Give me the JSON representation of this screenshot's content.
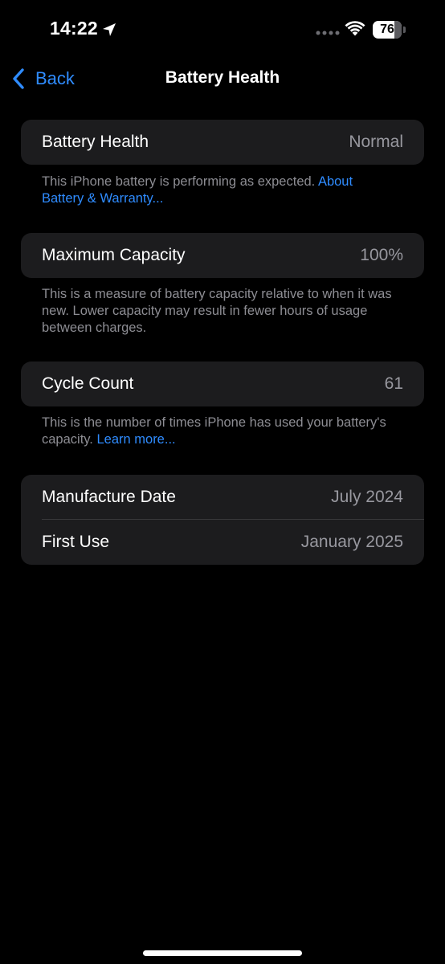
{
  "status_bar": {
    "time": "14:22",
    "battery_level": "76",
    "battery_fraction": 0.76,
    "icons": [
      "location-arrow-icon",
      "signal-dots-icon",
      "wifi-icon",
      "battery-icon"
    ]
  },
  "nav": {
    "back_label": "Back",
    "title": "Battery Health"
  },
  "battery_health": {
    "label": "Battery Health",
    "value": "Normal",
    "footnote": "This iPhone battery is performing as expected. ",
    "footnote_link": "About Battery & Warranty..."
  },
  "maximum_capacity": {
    "label": "Maximum Capacity",
    "value": "100%",
    "footnote": "This is a measure of battery capacity relative to when it was new. Lower capacity may result in fewer hours of usage between charges."
  },
  "cycle_count": {
    "label": "Cycle Count",
    "value": "61",
    "footnote": "This is the number of times iPhone has used your battery's capacity. ",
    "footnote_link": "Learn more..."
  },
  "dates": {
    "manufacture_label": "Manufacture Date",
    "manufacture_value": "July 2024",
    "first_use_label": "First Use",
    "first_use_value": "January 2025"
  },
  "colors": {
    "background": "#000000",
    "cell_background": "#1c1c1e",
    "accent": "#2f8cff",
    "secondary_text": "#98989f"
  }
}
